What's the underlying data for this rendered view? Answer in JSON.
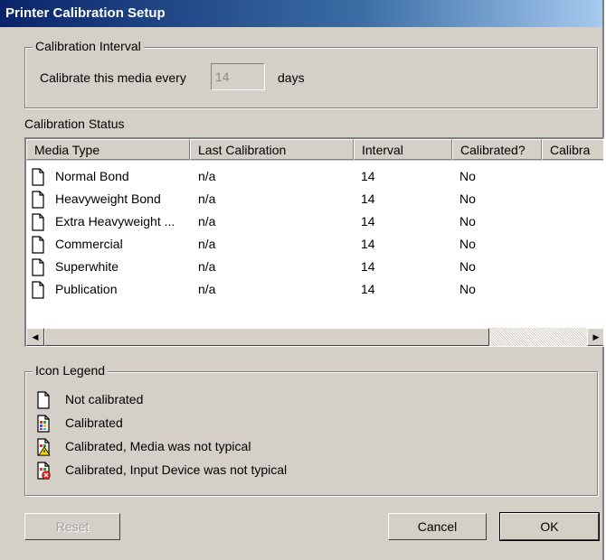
{
  "window": {
    "title": "Printer Calibration Setup"
  },
  "interval_group": {
    "label": "Calibration Interval",
    "prefix": "Calibrate this media every",
    "value": "14",
    "suffix": "days"
  },
  "status_group": {
    "label": "Calibration Status",
    "columns": [
      "Media Type",
      "Last Calibration",
      "Interval",
      "Calibrated?",
      "Calibra"
    ],
    "rows": [
      {
        "media": "Normal Bond",
        "last": "n/a",
        "interval": "14",
        "calibrated": "No",
        "icon": "not-calibrated-icon"
      },
      {
        "media": "Heavyweight Bond",
        "last": "n/a",
        "interval": "14",
        "calibrated": "No",
        "icon": "not-calibrated-icon"
      },
      {
        "media": "Extra Heavyweight ...",
        "last": "n/a",
        "interval": "14",
        "calibrated": "No",
        "icon": "not-calibrated-icon"
      },
      {
        "media": "Commercial",
        "last": "n/a",
        "interval": "14",
        "calibrated": "No",
        "icon": "not-calibrated-icon"
      },
      {
        "media": "Superwhite",
        "last": "n/a",
        "interval": "14",
        "calibrated": "No",
        "icon": "not-calibrated-icon"
      },
      {
        "media": "Publication",
        "last": "n/a",
        "interval": "14",
        "calibrated": "No",
        "icon": "not-calibrated-icon"
      }
    ],
    "scroll_left": "◀",
    "scroll_right": "▶"
  },
  "legend_group": {
    "label": "Icon Legend",
    "items": [
      {
        "text": "Not calibrated",
        "icon": "not-calibrated-icon"
      },
      {
        "text": "Calibrated",
        "icon": "calibrated-icon"
      },
      {
        "text": "Calibrated, Media was not typical",
        "icon": "media-warning-icon"
      },
      {
        "text": "Calibrated, Input Device was not typical",
        "icon": "input-device-error-icon"
      }
    ]
  },
  "buttons": {
    "reset": "Reset",
    "cancel": "Cancel",
    "ok": "OK"
  },
  "colors": {
    "title_start": "#0a246a",
    "face": "#d4d0c8",
    "warning": "#f5d800",
    "error": "#e02020"
  }
}
